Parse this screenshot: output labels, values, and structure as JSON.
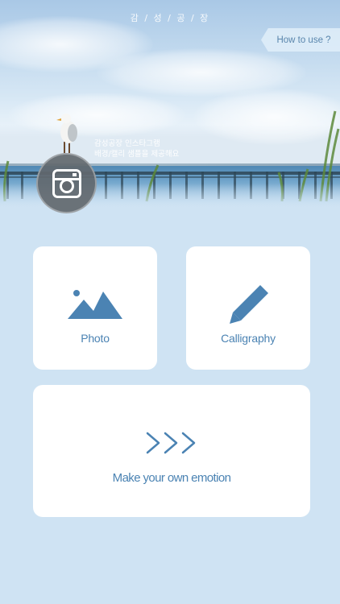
{
  "app": {
    "title": "감 / 성 / 공 / 장"
  },
  "header": {
    "help_label": "How to use ?"
  },
  "promo": {
    "line1": "감성공장 인스타그램",
    "line2": "배경/캘리 샘플을 제공해요",
    "button_icon": "instagram-icon"
  },
  "menu": {
    "photo": {
      "label": "Photo",
      "icon": "mountain-image-icon"
    },
    "calligraphy": {
      "label": "Calligraphy",
      "icon": "pencil-icon"
    },
    "make": {
      "label": "Make your own emotion",
      "icon": "triple-chevron-right-icon"
    }
  },
  "colors": {
    "background": "#cfe3f3",
    "accent": "#4b83b3",
    "card": "#ffffff",
    "badge": "#62686e"
  }
}
